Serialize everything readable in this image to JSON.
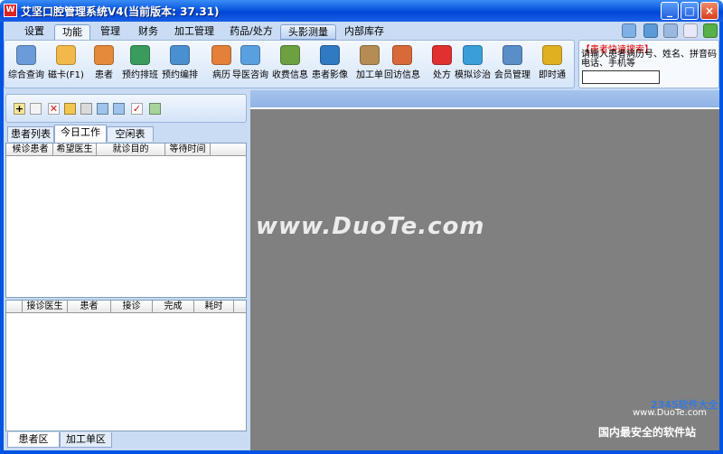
{
  "window": {
    "app_icon": "W",
    "title": "艾坚口腔管理系统V4(当前版本: 37.31)",
    "min_glyph": "_",
    "max_glyph": "□",
    "close_glyph": "×"
  },
  "menu_tabs": [
    {
      "label": "设置"
    },
    {
      "label": "功能"
    },
    {
      "label": "管理"
    },
    {
      "label": "财务"
    },
    {
      "label": "加工管理"
    },
    {
      "label": "药品/处方"
    },
    {
      "label": "头影测量"
    },
    {
      "label": "内部库存"
    }
  ],
  "ribbon_tools": [
    {
      "label": "综合查询",
      "icon": "magnifier-icon",
      "color": "#6b9bd8"
    },
    {
      "label": "磁卡(F1)",
      "icon": "card-icon",
      "color": "#f2b94a"
    },
    {
      "label": "患者",
      "icon": "patient-icon",
      "color": "#e58a3a"
    },
    {
      "label": "预约排班",
      "icon": "schedule-icon",
      "color": "#3a9c5c"
    },
    {
      "label": "预约编排",
      "icon": "appointment-icon",
      "color": "#4a8fd0"
    },
    {
      "label": "病历",
      "icon": "record-icon",
      "color": "#e4803a"
    },
    {
      "label": "导医咨询",
      "icon": "guide-icon",
      "color": "#5aa0e0"
    },
    {
      "label": "收费信息",
      "icon": "cash-icon",
      "color": "#6ca040"
    },
    {
      "label": "患者影像",
      "icon": "image-icon",
      "color": "#2f7ac0"
    },
    {
      "label": "加工单",
      "icon": "work-order-icon",
      "color": "#b58c54"
    },
    {
      "label": "回访信息",
      "icon": "house-icon",
      "color": "#d86a3a"
    },
    {
      "label": "处方",
      "icon": "prescription-icon",
      "color": "#e03030"
    },
    {
      "label": "模拟诊治",
      "icon": "simulate-icon",
      "color": "#3a9fd8"
    },
    {
      "label": "会员管理",
      "icon": "member-card-icon",
      "color": "#5a8ec8"
    },
    {
      "label": "即时通",
      "icon": "chat-icon",
      "color": "#e0b020"
    }
  ],
  "right_icons": [
    {
      "name": "search-icon",
      "color": "#7fb0e8"
    },
    {
      "name": "network-icon",
      "color": "#5a9ad8"
    },
    {
      "name": "window-icon",
      "color": "#9bb8e0"
    },
    {
      "name": "message-icon",
      "color": "#e8e8f8"
    },
    {
      "name": "help-icon",
      "color": "#58b048"
    }
  ],
  "quick_search": {
    "title": "【患者快速搜索】",
    "hint": "请输入患者病历号、姓名、拼音码电话、手机等",
    "value": ""
  },
  "left_toolbar_icons": [
    {
      "name": "new-icon",
      "glyph": "+",
      "color": "#f5e59a"
    },
    {
      "name": "copy-icon",
      "glyph": "",
      "color": "#f3f3f3"
    },
    {
      "name": "delete-icon",
      "glyph": "✕",
      "color": "#ffffff"
    },
    {
      "name": "open-icon",
      "glyph": "",
      "color": "#f2c64e"
    },
    {
      "name": "edit-icon",
      "glyph": "",
      "color": "#dadada"
    },
    {
      "name": "import-icon",
      "glyph": "",
      "color": "#9fc4ec"
    },
    {
      "name": "back-icon",
      "glyph": "",
      "color": "#9fc4ec"
    },
    {
      "name": "confirm-icon",
      "glyph": "✓",
      "color": "#ffffff"
    },
    {
      "name": "export-icon",
      "glyph": "",
      "color": "#a6d49a"
    }
  ],
  "sub_tabs": [
    {
      "label": "患者列表"
    },
    {
      "label": "今日工作"
    },
    {
      "label": "空闲表"
    }
  ],
  "waiting_table": {
    "columns": [
      "候诊患者",
      "希望医生",
      "就诊目的",
      "等待时间"
    ]
  },
  "visit_table": {
    "columns": [
      "",
      "接诊医生",
      "患者",
      "接诊",
      "完成",
      "耗时"
    ]
  },
  "bottom_tabs": [
    {
      "label": "患者区"
    },
    {
      "label": "加工单区"
    }
  ],
  "watermarks": {
    "main": "www.DuoTe.com",
    "logo": "2345软件大全",
    "url": "www.DuoTe.com",
    "slogan": "国内最安全的软件站"
  }
}
